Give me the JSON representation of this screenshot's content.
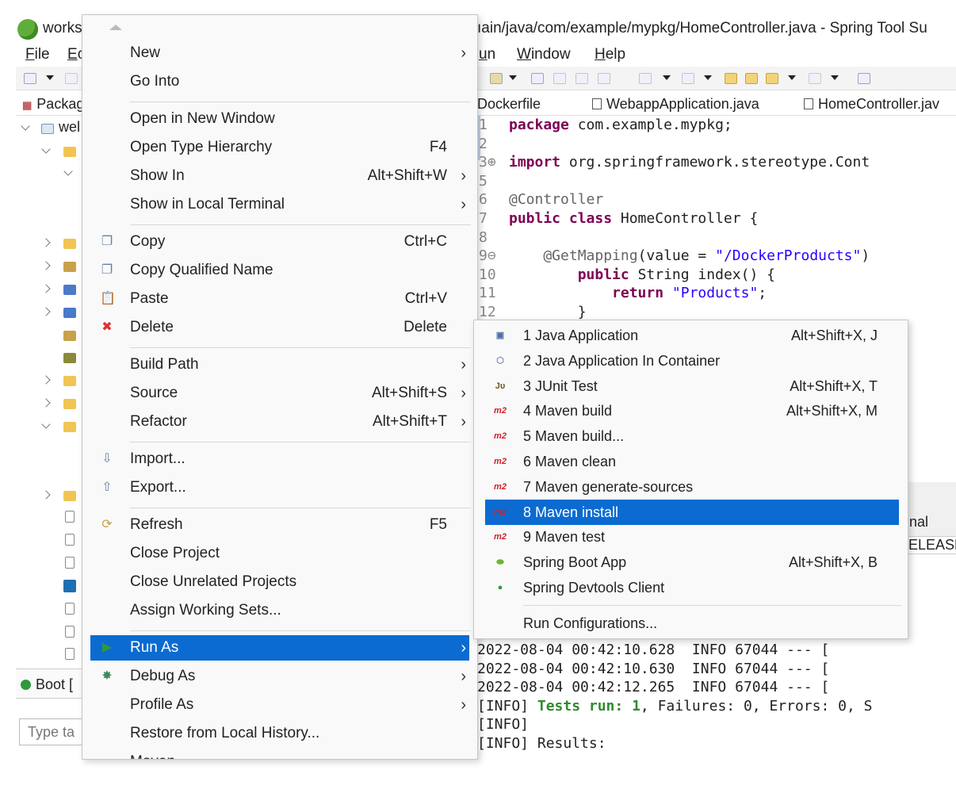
{
  "window": {
    "title_left": "works",
    "title_right": "ıain/java/com/example/mypkg/HomeController.java - Spring Tool Su"
  },
  "menubar": [
    "File",
    "Ec",
    "un",
    "Window",
    "Help"
  ],
  "package_explorer": {
    "header": "Packag",
    "project": "wel"
  },
  "boot_dashboard": {
    "header": "Boot [",
    "filter_placeholder": "Type ta"
  },
  "editor_tabs": [
    "Dockerfile",
    "WebappApplication.java",
    "HomeController.jav"
  ],
  "code": [
    {
      "n": "1",
      "parts": [
        {
          "t": "package",
          "c": "kw"
        },
        {
          "t": " com.example.mypkg;",
          "c": ""
        }
      ]
    },
    {
      "n": "2",
      "parts": []
    },
    {
      "n": "3⊕",
      "parts": [
        {
          "t": "import",
          "c": "kw"
        },
        {
          "t": " org.springframework.stereotype.Cont",
          "c": ""
        }
      ]
    },
    {
      "n": "5",
      "parts": []
    },
    {
      "n": "6",
      "parts": [
        {
          "t": "@Controller",
          "c": "ann"
        }
      ]
    },
    {
      "n": "7",
      "parts": [
        {
          "t": "public class",
          "c": "kw"
        },
        {
          "t": " HomeController {",
          "c": ""
        }
      ]
    },
    {
      "n": "8",
      "parts": []
    },
    {
      "n": "9⊖",
      "parts": [
        {
          "t": "    @GetMapping",
          "c": "ann"
        },
        {
          "t": "(value = ",
          "c": ""
        },
        {
          "t": "\"/DockerProducts\"",
          "c": "str"
        },
        {
          "t": ")",
          "c": ""
        }
      ]
    },
    {
      "n": "10",
      "parts": [
        {
          "t": "        ",
          "c": ""
        },
        {
          "t": "public",
          "c": "kw"
        },
        {
          "t": " String index() {",
          "c": ""
        }
      ]
    },
    {
      "n": "11",
      "parts": [
        {
          "t": "            ",
          "c": ""
        },
        {
          "t": "return",
          "c": "kw"
        },
        {
          "t": " ",
          "c": ""
        },
        {
          "t": "\"Products\"",
          "c": "str"
        },
        {
          "t": ";",
          "c": ""
        }
      ]
    },
    {
      "n": "12",
      "parts": [
        {
          "t": "        }",
          "c": ""
        }
      ]
    }
  ],
  "console_side": {
    "label": "nal",
    "label2": "ELEASE"
  },
  "console": [
    [
      {
        "t": "2022-08-04 00:42:10.628  INFO 67044 --- [",
        "c": ""
      }
    ],
    [
      {
        "t": "2022-08-04 00:42:10.630  INFO 67044 --- [",
        "c": ""
      }
    ],
    [
      {
        "t": "2022-08-04 00:42:12.265  INFO 67044 --- [",
        "c": ""
      }
    ],
    [
      {
        "t": "[INFO] ",
        "c": ""
      },
      {
        "t": "Tests run: 1",
        "c": "info-green"
      },
      {
        "t": ", Failures: 0, Errors: 0, S",
        "c": ""
      }
    ],
    [
      {
        "t": "[INFO]",
        "c": ""
      }
    ],
    [
      {
        "t": "[INFO] Results:",
        "c": ""
      }
    ]
  ],
  "context_menu": {
    "items": [
      {
        "label": "New",
        "submenu": true
      },
      {
        "label": "Go Into"
      },
      {
        "sep": true
      },
      {
        "label": "Open in New Window"
      },
      {
        "label": "Open Type Hierarchy",
        "shortcut": "F4"
      },
      {
        "label": "Show In",
        "shortcut": "Alt+Shift+W",
        "submenu": true
      },
      {
        "label": "Show in Local Terminal",
        "submenu": true
      },
      {
        "sep": true
      },
      {
        "label": "Copy",
        "shortcut": "Ctrl+C",
        "icon": "copy-icon"
      },
      {
        "label": "Copy Qualified Name",
        "icon": "copy-qualified-icon"
      },
      {
        "label": "Paste",
        "shortcut": "Ctrl+V",
        "icon": "paste-icon"
      },
      {
        "label": "Delete",
        "shortcut": "Delete",
        "icon": "delete-icon"
      },
      {
        "sep": true
      },
      {
        "label": "Build Path",
        "submenu": true
      },
      {
        "label": "Source",
        "shortcut": "Alt+Shift+S",
        "submenu": true
      },
      {
        "label": "Refactor",
        "shortcut": "Alt+Shift+T",
        "submenu": true
      },
      {
        "sep": true
      },
      {
        "label": "Import...",
        "icon": "import-icon"
      },
      {
        "label": "Export...",
        "icon": "export-icon"
      },
      {
        "sep": true
      },
      {
        "label": "Refresh",
        "shortcut": "F5",
        "icon": "refresh-icon"
      },
      {
        "label": "Close Project"
      },
      {
        "label": "Close Unrelated Projects"
      },
      {
        "label": "Assign Working Sets..."
      },
      {
        "sep": true
      },
      {
        "label": "Run As",
        "submenu": true,
        "selected": true,
        "icon": "run-icon"
      },
      {
        "label": "Debug As",
        "submenu": true,
        "icon": "debug-icon"
      },
      {
        "label": "Profile As",
        "submenu": true
      },
      {
        "label": "Restore from Local History..."
      },
      {
        "label": "Maven",
        "submenu": true
      }
    ]
  },
  "run_as_submenu": {
    "items": [
      {
        "label": "1 Java Application",
        "shortcut": "Alt+Shift+X, J",
        "icon": "java-app-icon"
      },
      {
        "label": "2 Java Application In Container",
        "icon": "container-icon"
      },
      {
        "label": "3 JUnit Test",
        "shortcut": "Alt+Shift+X, T",
        "icon": "junit-icon"
      },
      {
        "label": "4 Maven build",
        "shortcut": "Alt+Shift+X, M",
        "icon": "maven-icon"
      },
      {
        "label": "5 Maven build...",
        "icon": "maven-icon"
      },
      {
        "label": "6 Maven clean",
        "icon": "maven-icon"
      },
      {
        "label": "7 Maven generate-sources",
        "icon": "maven-icon"
      },
      {
        "label": "8 Maven install",
        "icon": "maven-icon",
        "selected": true
      },
      {
        "label": "9 Maven test",
        "icon": "maven-icon"
      },
      {
        "label": "Spring Boot App",
        "shortcut": "Alt+Shift+X, B",
        "icon": "spring-boot-icon"
      },
      {
        "label": "Spring Devtools Client",
        "icon": "spring-devtools-icon"
      },
      {
        "sep": true
      },
      {
        "label": "Run Configurations..."
      }
    ]
  },
  "icon_text": {
    "junit": "Jυ",
    "maven": "m2"
  },
  "colors": {
    "selection": "#0b6bd1",
    "keyword": "#7f0055",
    "string": "#2a00ff",
    "delete": "#e03030"
  }
}
